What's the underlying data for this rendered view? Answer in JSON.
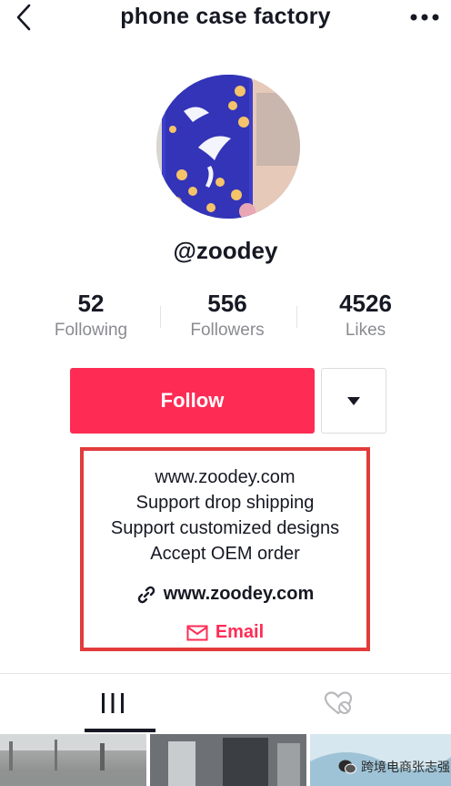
{
  "header": {
    "title": "phone case factory"
  },
  "profile": {
    "username": "@zoodey"
  },
  "stats": [
    {
      "value": "52",
      "label": "Following"
    },
    {
      "value": "556",
      "label": "Followers"
    },
    {
      "value": "4526",
      "label": "Likes"
    }
  ],
  "actions": {
    "follow_label": "Follow"
  },
  "bio": {
    "lines": [
      "www.zoodey.com",
      "Support drop shipping",
      "Support customized designs",
      "Accept OEM order"
    ],
    "link": "www.zoodey.com",
    "email_label": "Email"
  },
  "tabs": {
    "videos_icon": "grid-bars-icon",
    "liked_icon": "liked-heart-hidden-icon"
  },
  "watermark": {
    "text": "跨境电商张志强"
  },
  "colors": {
    "accent": "#fe2c55",
    "highlight_box": "#e23b3b"
  }
}
